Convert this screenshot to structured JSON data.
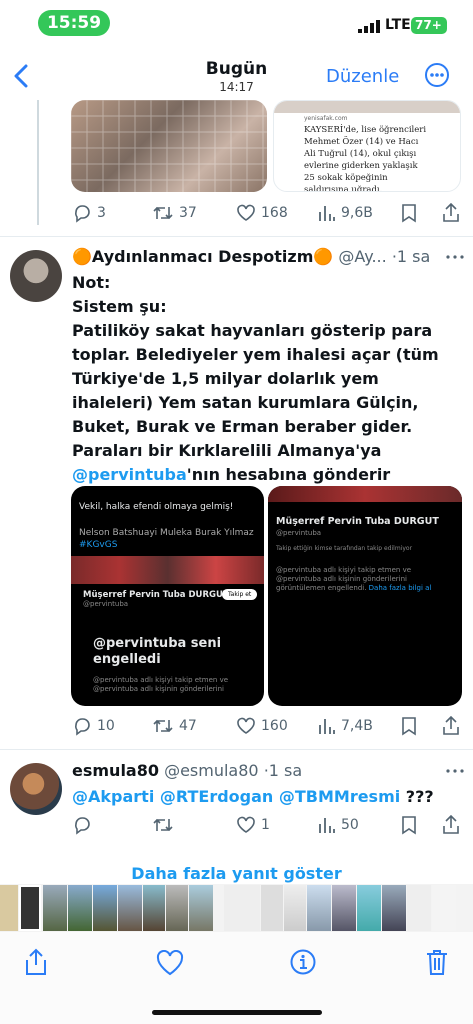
{
  "status_bar": {
    "time": "15:59",
    "network": "LTE",
    "battery": "77+"
  },
  "nav": {
    "title": "Bugün",
    "subtitle": "14:17",
    "edit_label": "Düzenle"
  },
  "tweet1": {
    "article_source": "yenisafak.com",
    "article_text": "KAYSERİ'de, lise öğrencileri Mehmet Özer (14) ve Hacı Ali Tuğrul (14), okul çıkışı evlerine giderken yaklaşık 25 sokak köpeğinin saldırısına uğradı. Köpeklerin arasında kalan öğrencilerden",
    "replies": "3",
    "retweets": "37",
    "likes": "168",
    "views": "9,6B"
  },
  "tweet2": {
    "name": "🟠Aydınlanmacı Despotizm🟠",
    "handle": "@Ay...",
    "time": "·1 sa",
    "text_pre": "Not:\nSistem şu:\nPatiliköy sakat hayvanları gösterip para toplar. Belediyeler yem ihalesi açar (tüm Türkiye'de 1,5 milyar dolarlık yem ihaleleri) Yem satan kurumlara Gülçin, Buket, Burak ve Erman beraber gider. Paraları bir Kırklarelili Almanya'ya ",
    "mention": "@pervintuba",
    "text_post": "'nın hesabına gönderir",
    "left_img": {
      "top_text": "Vekil, halka efendi olmaya gelmiş!",
      "names_text": "Nelson Batshuayi Muleka Burak Yılmaz",
      "hashtag": "#KGvGS",
      "follow_btn": "Takip et",
      "profile_name": "Müşerref Pervin Tuba DURGUT",
      "profile_handle": "@pervintuba",
      "blocked_title": "@pervintuba seni engelledi",
      "blocked_desc": "@pervintuba adlı kişiyi takip etmen ve @pervintuba adlı kişinin gönderilerini"
    },
    "right_img": {
      "profile_name": "Müşerref Pervin Tuba DURGUT",
      "profile_handle": "@pervintuba",
      "follow_info": "Takip ettiğin kimse tarafından takip edilmiyor",
      "blocked_desc": "@pervintuba adlı kişiyi takip etmen ve @pervintuba adlı kişinin gönderilerini görüntülemen engellendi.",
      "more_link": "Daha fazla bilgi al"
    },
    "replies": "10",
    "retweets": "47",
    "likes": "160",
    "views": "7,4B"
  },
  "tweet3": {
    "name": "esmula80",
    "handle": "@esmula80",
    "time": "·1 sa",
    "mentions": "@Akparti @RTErdogan @TBMMresmi",
    "suffix": " ???",
    "replies": "",
    "retweets": "",
    "likes": "1",
    "views": "50"
  },
  "show_more": "Daha fazla yanıt göster",
  "colors": {
    "accent": "#1d9bf0",
    "ios_blue": "#2b7cf6",
    "status_green": "#34c759"
  },
  "toolbar_icons": [
    "share-icon",
    "heart-icon",
    "info-icon",
    "trash-icon"
  ]
}
